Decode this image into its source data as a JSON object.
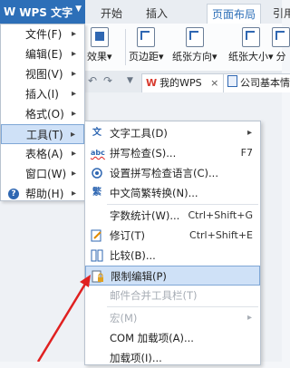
{
  "app": {
    "title": "WPS 文字",
    "logo": "W"
  },
  "tabs": [
    {
      "label": "开始"
    },
    {
      "label": "插入"
    },
    {
      "label": "页面布局",
      "active": true
    },
    {
      "label": "引用"
    }
  ],
  "ribbon": {
    "effects": "效果",
    "margins": "页边距",
    "orientation": "纸张方向",
    "size": "纸张大小",
    "columns": "分"
  },
  "doctabs": {
    "mywps": "我的WPS",
    "close": "×",
    "doc": "公司基本情"
  },
  "main_menu": [
    {
      "label": "文件(F)"
    },
    {
      "label": "编辑(E)"
    },
    {
      "label": "视图(V)"
    },
    {
      "label": "插入(I)"
    },
    {
      "label": "格式(O)"
    },
    {
      "label": "工具(T)"
    },
    {
      "label": "表格(A)"
    },
    {
      "label": "窗口(W)"
    },
    {
      "label": "帮助(H)"
    }
  ],
  "tools_menu": [
    {
      "label": "文字工具(D)"
    },
    {
      "label": "拼写检查(S)...",
      "shortcut": "F7"
    },
    {
      "label": "设置拼写检查语言(C)..."
    },
    {
      "label": "中文简繁转换(N)..."
    },
    {
      "label": "字数统计(W)...",
      "shortcut": "Ctrl+Shift+G"
    },
    {
      "label": "修订(T)",
      "shortcut": "Ctrl+Shift+E"
    },
    {
      "label": "比较(B)..."
    },
    {
      "label": "限制编辑(P)"
    },
    {
      "label": "邮件合并工具栏(T)"
    },
    {
      "label": "宏(M)"
    },
    {
      "label": "COM 加载项(A)..."
    },
    {
      "label": "加载项(I)..."
    }
  ],
  "icons": {
    "abc": "abc",
    "help": "?"
  },
  "colors": {
    "brand": "#2d6fb8",
    "highlight": "#cfe1f7",
    "arrow": "#e02020"
  }
}
